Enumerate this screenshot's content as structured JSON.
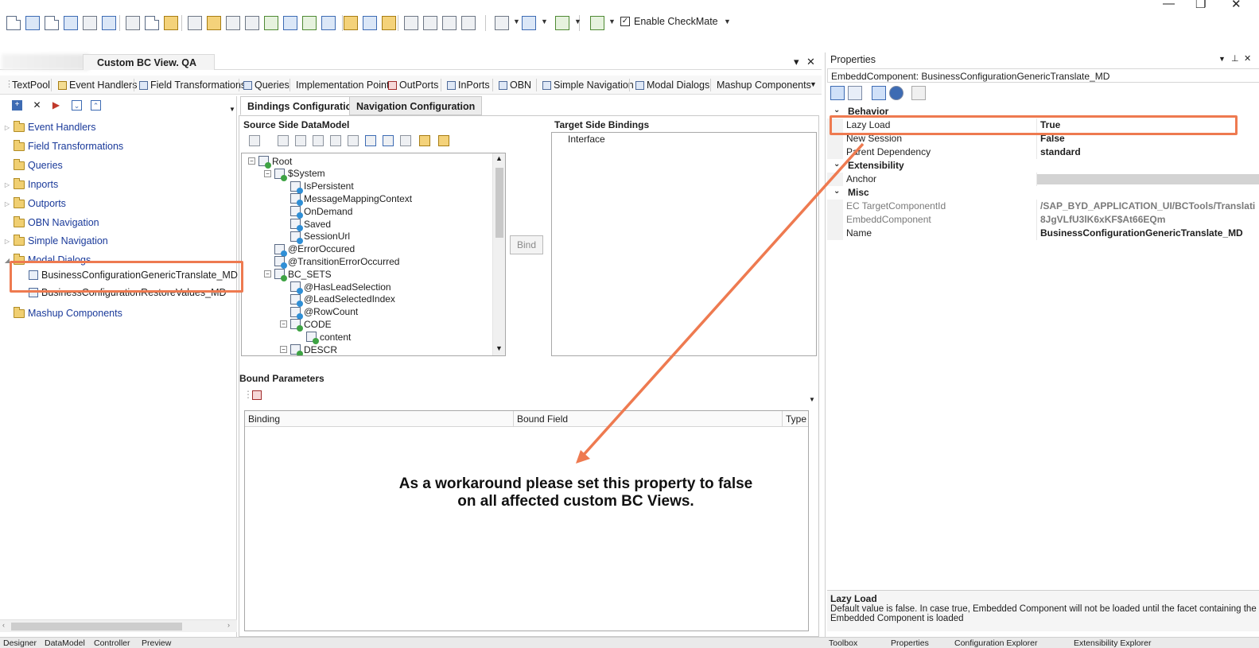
{
  "toolbar": {
    "enable_checkmate_label": "Enable CheckMate",
    "enable_checkmate_checked": true,
    "icons": [
      "new-icon",
      "save-icon",
      "save-all-icon",
      "copy-icon",
      "edit-icon",
      "page-icon",
      "cut-icon",
      "copy-icon",
      "paste-icon",
      "find-icon",
      "find-replace-icon",
      "wrench-icon",
      "tools-icon",
      "calculator-icon",
      "window-icon",
      "globe-icon",
      "layout-icon",
      "export-icon",
      "refresh-icon",
      "brush-icon",
      "tree-icon",
      "hierarchy-icon",
      "remove-node-icon",
      "delete-node-icon",
      "preview-icon",
      "help-icon",
      "xml-icon",
      "run-icon"
    ]
  },
  "window_controls": {
    "minimize": "—",
    "restore": "❐",
    "close": "✕"
  },
  "document": {
    "tab_title": "Custom BC View. QA"
  },
  "component_tabs": [
    {
      "label": "TextPool"
    },
    {
      "label": "Event Handlers"
    },
    {
      "label": "Field Transformations"
    },
    {
      "label": "Queries"
    },
    {
      "label": "Implementation Points"
    },
    {
      "label": "OutPorts"
    },
    {
      "label": "InPorts"
    },
    {
      "label": "OBN"
    },
    {
      "label": "Simple Navigation"
    },
    {
      "label": "Modal Dialogs"
    },
    {
      "label": "Mashup Components"
    }
  ],
  "left_tree": {
    "items": [
      {
        "label": "Event Handlers",
        "expandable": true
      },
      {
        "label": "Field Transformations",
        "expandable": false
      },
      {
        "label": "Queries",
        "expandable": false
      },
      {
        "label": "Inports",
        "expandable": true
      },
      {
        "label": "Outports",
        "expandable": true
      },
      {
        "label": "OBN Navigation",
        "expandable": false
      },
      {
        "label": "Simple Navigation",
        "expandable": true
      },
      {
        "label": "Modal Dialogs",
        "expandable": true,
        "expanded": true
      },
      {
        "label": "Mashup Components",
        "expandable": false
      }
    ],
    "modal_children": [
      {
        "label": "BusinessConfigurationGenericTranslate_MD"
      },
      {
        "label": "BusinessConfigurationRestoreValues_MD"
      }
    ]
  },
  "center": {
    "tabs": [
      {
        "label": "Bindings Configuration",
        "active": true
      },
      {
        "label": "Navigation Configuration",
        "active": false
      }
    ],
    "source_title": "Source Side DataModel",
    "target_title": "Target Side Bindings",
    "target_root": "Interface",
    "bind_button": "Bind",
    "bound_title": "Bound Parameters",
    "bound_columns": [
      "Binding",
      "Bound Field",
      "Type"
    ],
    "datamodel": [
      {
        "label": "Root",
        "depth": 0,
        "toggle": "−",
        "dot": "g"
      },
      {
        "label": "$System",
        "depth": 1,
        "toggle": "−",
        "dot": "g"
      },
      {
        "label": "IsPersistent",
        "depth": 2,
        "toggle": "",
        "dot": "b"
      },
      {
        "label": "MessageMappingContext",
        "depth": 2,
        "toggle": "",
        "dot": "b"
      },
      {
        "label": "OnDemand",
        "depth": 2,
        "toggle": "",
        "dot": "b"
      },
      {
        "label": "Saved",
        "depth": 2,
        "toggle": "",
        "dot": "b"
      },
      {
        "label": "SessionUrl",
        "depth": 2,
        "toggle": "",
        "dot": "b"
      },
      {
        "label": "@ErrorOccured",
        "depth": 1,
        "toggle": "",
        "dot": "b"
      },
      {
        "label": "@TransitionErrorOccurred",
        "depth": 1,
        "toggle": "",
        "dot": "b"
      },
      {
        "label": "BC_SETS",
        "depth": 1,
        "toggle": "−",
        "dot": "g"
      },
      {
        "label": "@HasLeadSelection",
        "depth": 2,
        "toggle": "",
        "dot": "b"
      },
      {
        "label": "@LeadSelectedIndex",
        "depth": 2,
        "toggle": "",
        "dot": "b"
      },
      {
        "label": "@RowCount",
        "depth": 2,
        "toggle": "",
        "dot": "b"
      },
      {
        "label": "CODE",
        "depth": 2,
        "toggle": "−",
        "dot": "g"
      },
      {
        "label": "content",
        "depth": 3,
        "toggle": "",
        "dot": "g"
      },
      {
        "label": "DESCR",
        "depth": 2,
        "toggle": "−",
        "dot": "g"
      }
    ]
  },
  "properties": {
    "panel_title": "Properties",
    "object": "EmbeddComponent: BusinessConfigurationGenericTranslate_MD",
    "categories": [
      {
        "name": "Behavior",
        "rows": [
          {
            "name": "Lazy Load",
            "value": "True",
            "readonly": false
          },
          {
            "name": "New Session",
            "value": "False",
            "readonly": false
          },
          {
            "name": "Parent Dependency",
            "value": "standard",
            "readonly": false
          }
        ]
      },
      {
        "name": "Extensibility",
        "rows": [
          {
            "name": "Anchor",
            "value": "",
            "readonly": false,
            "blurred": true
          }
        ]
      },
      {
        "name": "Misc",
        "rows": [
          {
            "name": "EC TargetComponentId",
            "value": "/SAP_BYD_APPLICATION_UI/BCTools/Translati",
            "readonly": true
          },
          {
            "name": "EmbeddComponent",
            "value": "8JgVLfU3lK6xKF$At66EQm",
            "readonly": true
          },
          {
            "name": "Name",
            "value": "BusinessConfigurationGenericTranslate_MD",
            "readonly": false
          }
        ]
      }
    ],
    "description_title": "Lazy Load",
    "description_text": "Default value is false. In case true, Embedded Component will not be loaded until the facet containing the Embedded Component is loaded"
  },
  "bottom_tabs": [
    "Designer",
    "DataModel",
    "Controller",
    "Preview"
  ],
  "bottom_right_tabs": [
    "Toolbox",
    "Properties",
    "Configuration Explorer",
    "Extensibility Explorer"
  ],
  "annotation": {
    "line1": "As a workaround please set this property to false",
    "line2": "on all affected custom BC Views.",
    "color": "#ee7a50"
  }
}
